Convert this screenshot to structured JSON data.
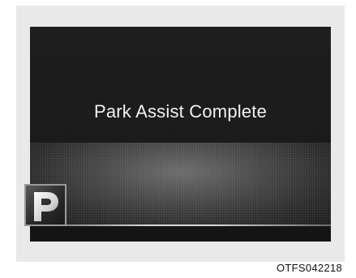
{
  "display": {
    "message": "Park Assist Complete",
    "badge_icon": "parking-icon"
  },
  "figure_code": "OTFS042218",
  "colors": {
    "frame": "#e9e9e9",
    "screen": "#1a1a1a",
    "text": "#f2f2f2"
  }
}
